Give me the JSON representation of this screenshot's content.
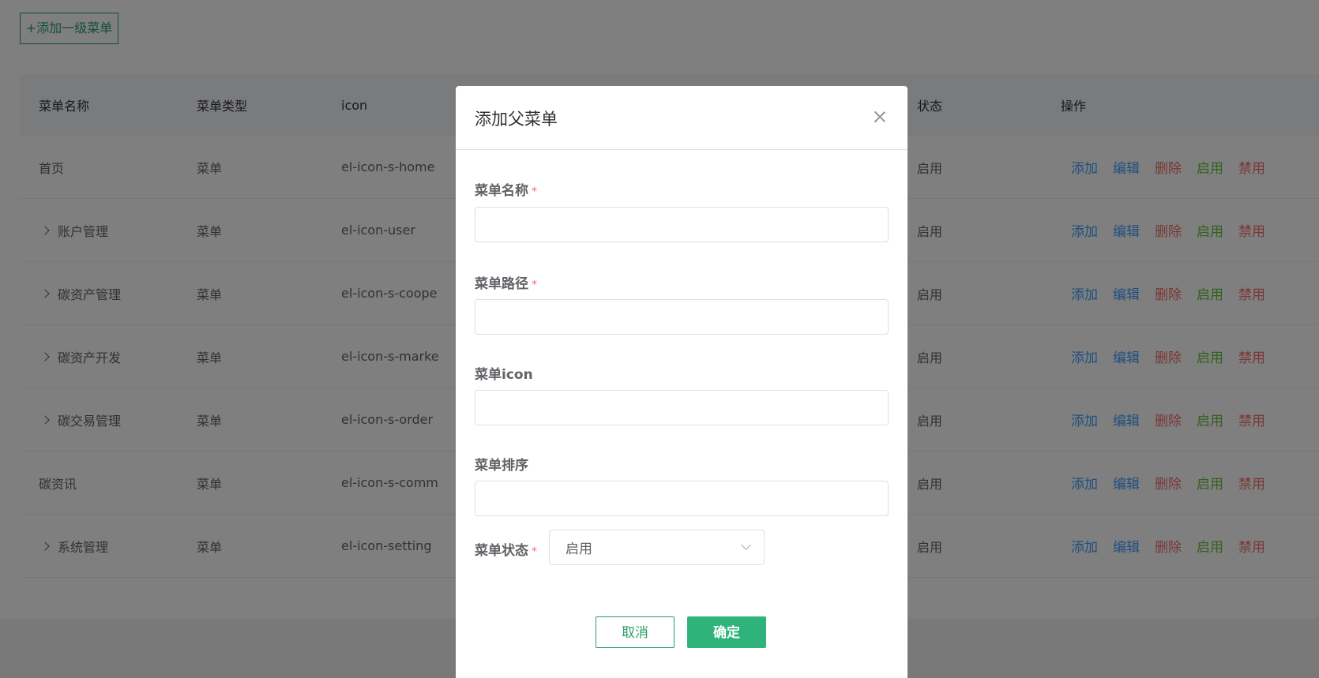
{
  "toolbar": {
    "add_top_label": "+添加一级菜单"
  },
  "table": {
    "headers": {
      "name": "菜单名称",
      "type": "菜单类型",
      "icon": "icon",
      "status": "状态",
      "ops": "操作"
    },
    "rows": [
      {
        "name": "首页",
        "expandable": false,
        "type": "菜单",
        "icon": "el-icon-s-home",
        "status": "启用"
      },
      {
        "name": "账户管理",
        "expandable": true,
        "type": "菜单",
        "icon": "el-icon-user",
        "status": "启用"
      },
      {
        "name": "碳资产管理",
        "expandable": true,
        "type": "菜单",
        "icon": "el-icon-s-coope",
        "status": "启用"
      },
      {
        "name": "碳资产开发",
        "expandable": true,
        "type": "菜单",
        "icon": "el-icon-s-marke",
        "status": "启用"
      },
      {
        "name": "碳交易管理",
        "expandable": true,
        "type": "菜单",
        "icon": "el-icon-s-order",
        "status": "启用"
      },
      {
        "name": "碳资讯",
        "expandable": false,
        "type": "菜单",
        "icon": "el-icon-s-comm",
        "status": "启用"
      },
      {
        "name": "系统管理",
        "expandable": true,
        "type": "菜单",
        "icon": "el-icon-setting",
        "status": "启用"
      }
    ],
    "ops": {
      "add": "添加",
      "edit": "编辑",
      "delete": "删除",
      "enable": "启用",
      "disable": "禁用"
    }
  },
  "dialog": {
    "title": "添加父菜单",
    "fields": {
      "name_label": "菜单名称",
      "name_value": "",
      "path_label": "菜单路径",
      "path_value": "",
      "icon_label": "菜单icon",
      "icon_value": "",
      "order_label": "菜单排序",
      "order_value": "",
      "status_label": "菜单状态",
      "status_value": "启用"
    },
    "required_mark": "*",
    "cancel_label": "取消",
    "confirm_label": "确定"
  },
  "colors": {
    "brand": "#2fb37b",
    "link_blue": "#409eff",
    "danger": "#f56c6c",
    "success": "#67c23a"
  }
}
